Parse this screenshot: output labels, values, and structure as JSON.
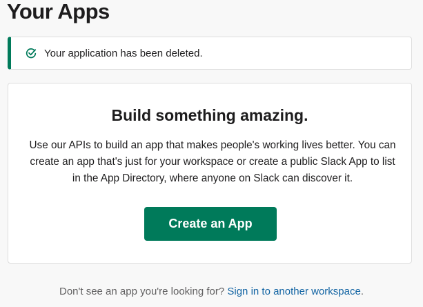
{
  "page": {
    "title": "Your Apps"
  },
  "alert": {
    "icon": "check-circle-icon",
    "message": "Your application has been deleted.",
    "color": "#007a5a"
  },
  "card": {
    "title": "Build something amazing.",
    "description": "Use our APIs to build an app that makes people's working lives better. You can create an app that's just for your workspace or create a public Slack App to list in the App Directory, where anyone on Slack can discover it.",
    "button_label": "Create an App",
    "button_color": "#007a5a"
  },
  "footer": {
    "prompt": "Don't see an app you're looking for? ",
    "link_label": "Sign in to another workspace",
    "suffix": ".",
    "link_color": "#1264a3"
  }
}
